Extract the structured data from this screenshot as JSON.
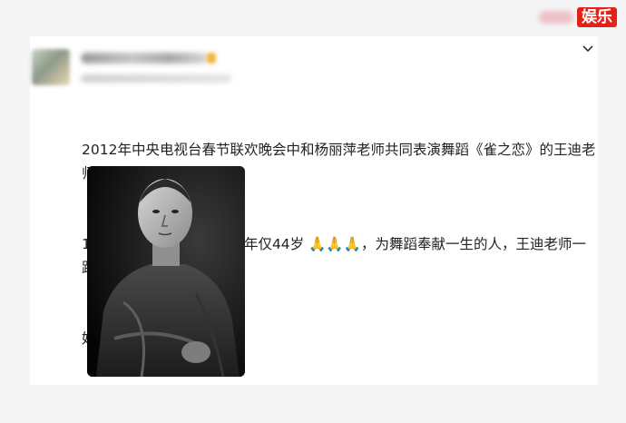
{
  "watermark": {
    "label": "娱乐"
  },
  "post": {
    "lines": [
      "2012年中央电视台春节联欢晚会中和杨丽萍老师共同表演舞蹈《雀之恋》的王迪老师，",
      "10月18日因抑郁症去世，年仅44岁 🙏🙏🙏，为舞蹈奉献一生的人，王迪老师一路走",
      "好！🙏🙏🙏"
    ]
  },
  "icons": {
    "more": "chevron-down-icon",
    "pray": "folded-hands-emoji"
  },
  "photo": {
    "description_icon": "portrait-photo"
  }
}
